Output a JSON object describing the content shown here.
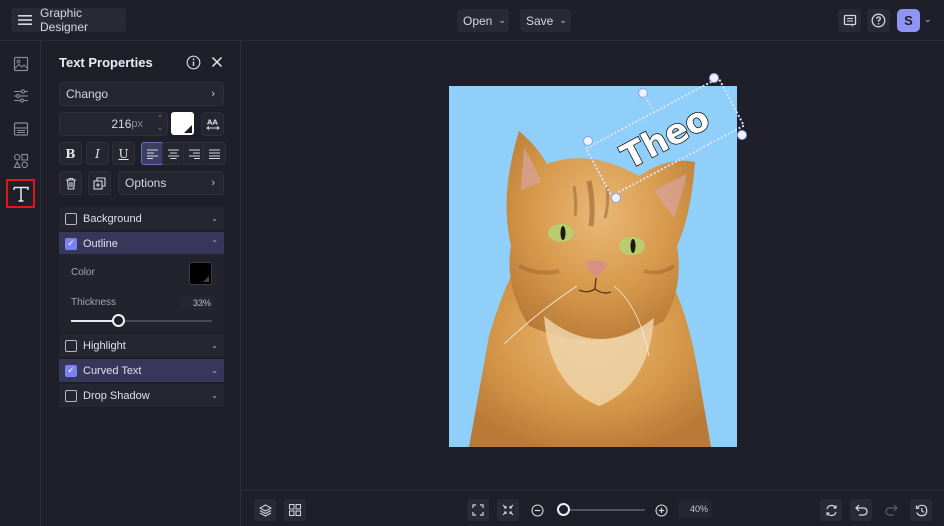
{
  "app": {
    "title": "Graphic Designer",
    "menu_open": "Open",
    "menu_save": "Save",
    "user_initial": "S"
  },
  "rail": {
    "items": [
      {
        "name": "image",
        "active": false
      },
      {
        "name": "adjustments",
        "active": false
      },
      {
        "name": "layout",
        "active": false
      },
      {
        "name": "elements",
        "active": false
      },
      {
        "name": "text",
        "active": true
      }
    ]
  },
  "panel": {
    "title": "Text Properties",
    "font": "Chango",
    "font_size": "216",
    "font_size_unit": "px",
    "text_color": "#ffffff",
    "align_active": "left",
    "options_label": "Options",
    "sections": {
      "background": {
        "label": "Background",
        "checked": false
      },
      "outline": {
        "label": "Outline",
        "checked": true,
        "expanded": true,
        "color_label": "Color",
        "color": "#000000",
        "thickness_label": "Thickness",
        "thickness": "33%",
        "thickness_fraction": 0.33
      },
      "highlight": {
        "label": "Highlight",
        "checked": false
      },
      "curved_text": {
        "label": "Curved Text",
        "checked": true
      },
      "drop_shadow": {
        "label": "Drop Shadow",
        "checked": false
      }
    }
  },
  "canvas": {
    "text_object": "Theo",
    "background_color": "#8fcff9",
    "image_subject": "orange tabby cat"
  },
  "bottom": {
    "zoom_value": "40%",
    "zoom_fraction": 0.1
  },
  "colors": {
    "accent": "#7a82ef",
    "active_row": "#37375a",
    "highlight_border": "#e0161b"
  }
}
